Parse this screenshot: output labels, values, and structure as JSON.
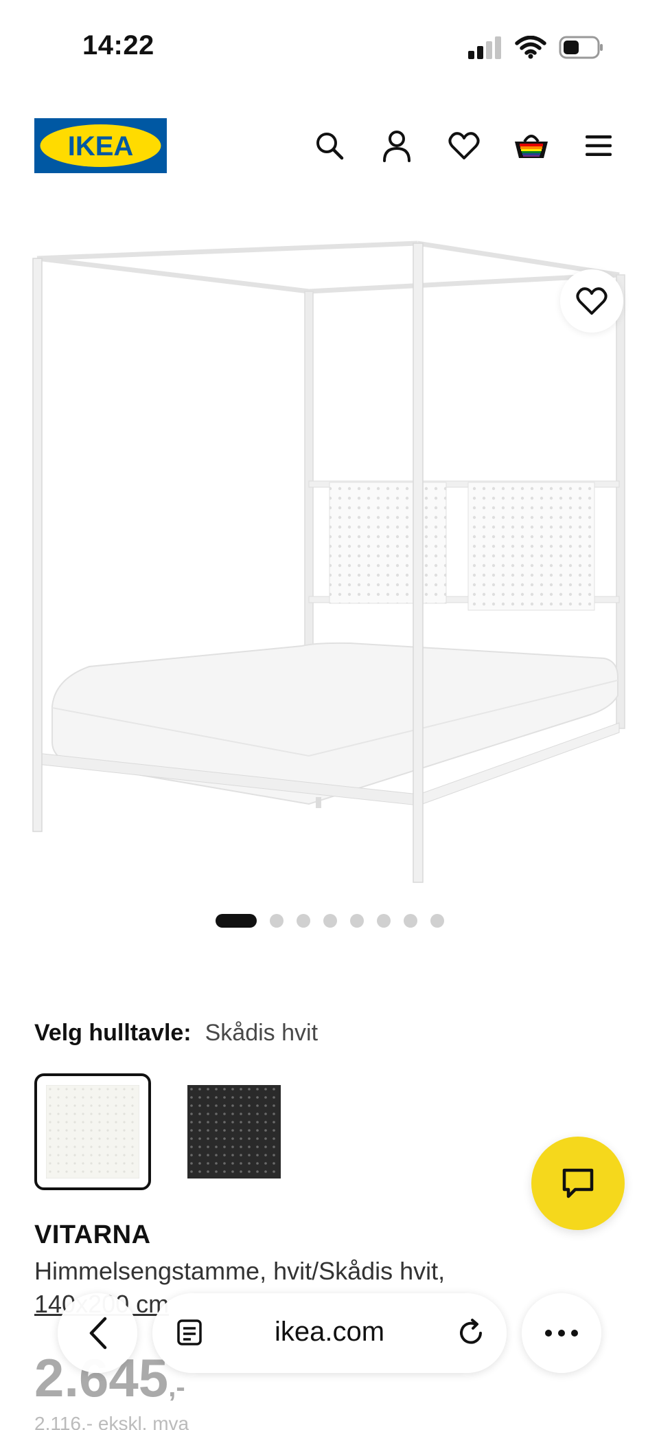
{
  "status_bar": {
    "time": "14:22",
    "icons": [
      "signal-icon",
      "wifi-icon",
      "battery-icon"
    ]
  },
  "header": {
    "logo_text": "IKEA",
    "icons": [
      "search-icon",
      "profile-icon",
      "heart-icon",
      "basket-icon",
      "menu-icon"
    ]
  },
  "colors": {
    "ikea_blue": "#0058a3",
    "ikea_yellow": "#ffdb00",
    "chat_yellow": "#f5d81c",
    "text_dark": "#111111"
  },
  "carousel": {
    "total_images": 8,
    "active_index": 0
  },
  "option": {
    "label": "Velg hulltavle:",
    "value": "Skådis hvit",
    "swatches": [
      {
        "name": "Skådis hvit",
        "color": "#f4f4f0",
        "selected": true
      },
      {
        "name": "Skådis svart",
        "color": "#2a2a2a",
        "selected": false
      }
    ]
  },
  "product": {
    "name": "VITARNA",
    "description": "Himmelsengstamme, hvit/Skådis hvit,",
    "size": "140x200 cm",
    "price": "2.645",
    "price_suffix": ",-",
    "price_ex_vat": "2.116,- ekskl. mva"
  },
  "browser": {
    "url": "ikea.com"
  }
}
